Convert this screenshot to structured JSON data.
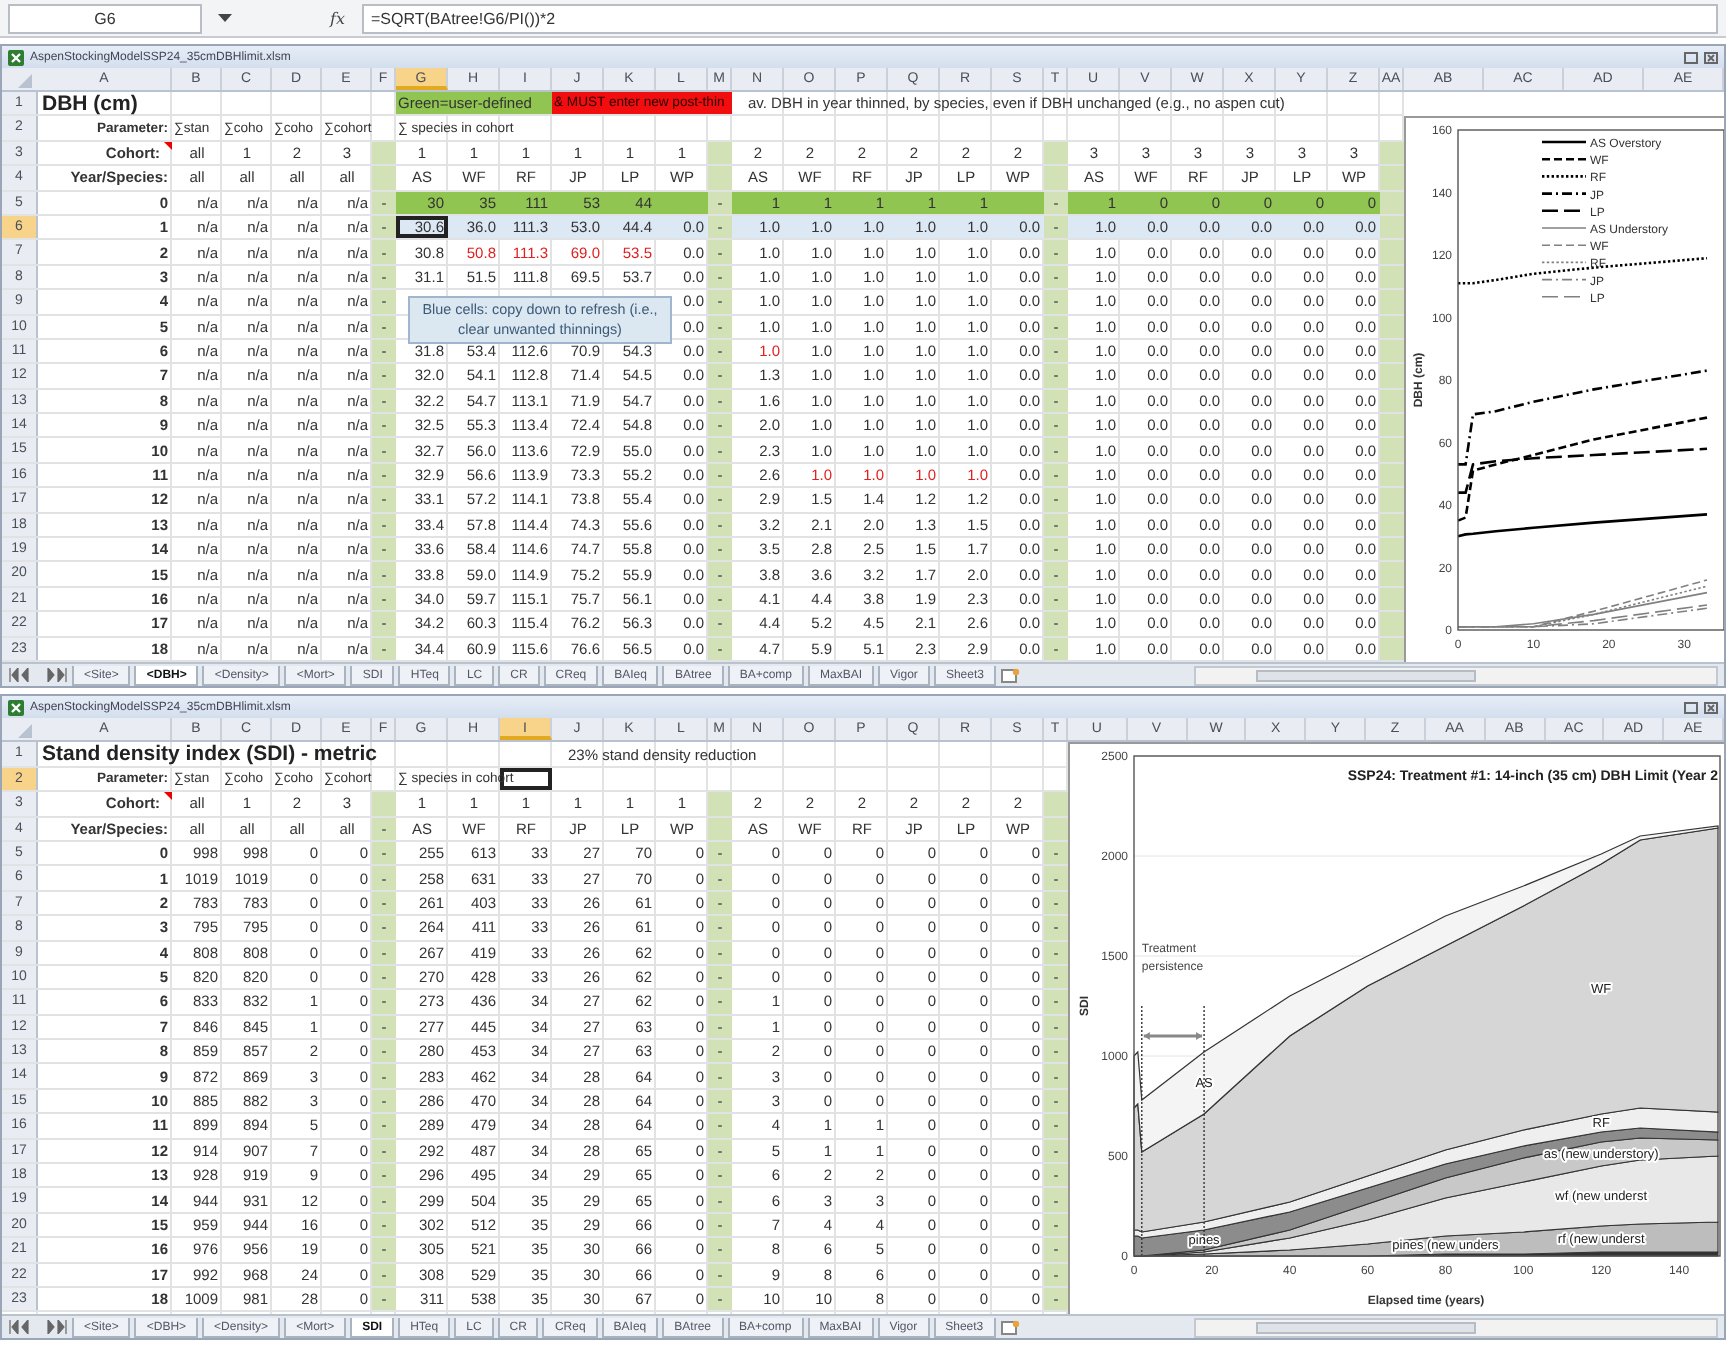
{
  "formula_bar": {
    "name_box": "G6",
    "fx": "fx",
    "formula": "=SQRT(BAtree!G6/PI())*2"
  },
  "windows": [
    {
      "title": "AspenStockingModelSSP24_35cmDBHlimit.xlsm",
      "columns": [
        {
          "label": "A",
          "selected": false
        },
        {
          "label": "B",
          "selected": false
        },
        {
          "label": "C",
          "selected": false
        },
        {
          "label": "D",
          "selected": false
        },
        {
          "label": "E",
          "selected": false
        },
        {
          "label": "F",
          "selected": false
        },
        {
          "label": "G",
          "selected": true
        },
        {
          "label": "H",
          "selected": false
        },
        {
          "label": "I",
          "selected": false
        },
        {
          "label": "J",
          "selected": false
        },
        {
          "label": "K",
          "selected": false
        },
        {
          "label": "L",
          "selected": false
        },
        {
          "label": "M",
          "selected": false
        },
        {
          "label": "N",
          "selected": false
        },
        {
          "label": "O",
          "selected": false
        },
        {
          "label": "P",
          "selected": false
        },
        {
          "label": "Q",
          "selected": false
        },
        {
          "label": "R",
          "selected": false
        },
        {
          "label": "S",
          "selected": false
        },
        {
          "label": "T",
          "selected": false
        },
        {
          "label": "U",
          "selected": false
        },
        {
          "label": "V",
          "selected": false
        },
        {
          "label": "W",
          "selected": false
        },
        {
          "label": "X",
          "selected": false
        },
        {
          "label": "Y",
          "selected": false
        },
        {
          "label": "Z",
          "selected": false
        },
        {
          "label": "AA",
          "selected": false
        },
        {
          "label": "AB",
          "selected": false
        },
        {
          "label": "AC",
          "selected": false
        },
        {
          "label": "AD",
          "selected": false
        },
        {
          "label": "AE",
          "selected": false
        }
      ],
      "rows": [
        {
          "num": "1",
          "selected": false,
          "cells": [
            {
              "text": "DBH (cm)",
              "kind": "title"
            },
            null,
            null,
            null,
            null,
            null,
            {
              "text": "Green=user-defined",
              "kind": "input"
            },
            {
              "kind": "input"
            },
            {
              "kind": "input"
            },
            {
              "text": "& MUST enter new post-thin",
              "kind": "alert"
            },
            {
              "kind": "alert"
            },
            {
              "kind": "alert"
            },
            {
              "kind": "alert"
            },
            {
              "text": "av. DBH in year thinned, by species, even if DBH unchanged (e.g., no aspen cut)",
              "kind": "note"
            }
          ]
        },
        {
          "num": "2",
          "selected": false,
          "cells": [
            "Parameter:",
            "∑stan",
            "∑coho",
            "∑coho",
            "∑cohort",
            null,
            "∑ species in cohort"
          ]
        },
        {
          "num": "3",
          "selected": false,
          "cells": [
            {
              "text": "Cohort:",
              "comment": true
            },
            "all",
            "1",
            "2",
            "3",
            null,
            "1",
            "1",
            "1",
            "1",
            "1",
            "1",
            null,
            "2",
            "2",
            "2",
            "2",
            "2",
            "2",
            null,
            "3",
            "3",
            "3",
            "3",
            "3",
            "3"
          ]
        },
        {
          "num": "4",
          "selected": false,
          "cells": [
            "Year/Species:",
            "all",
            "all",
            "all",
            "all",
            null,
            "AS",
            "WF",
            "RF",
            "JP",
            "LP",
            "WP",
            null,
            "AS",
            "WF",
            "RF",
            "JP",
            "LP",
            "WP",
            null,
            "AS",
            "WF",
            "RF",
            "JP",
            "LP",
            "WP"
          ]
        },
        {
          "num": "5",
          "selected": false,
          "kind": "input",
          "cells": [
            "0",
            "n/a",
            "n/a",
            "n/a",
            "n/a",
            "-",
            "30",
            "35",
            "111",
            "53",
            "44",
            null,
            "-",
            "1",
            "1",
            "1",
            "1",
            "1",
            null,
            "-",
            "1",
            "0",
            "0",
            "0",
            "0",
            "0"
          ]
        },
        {
          "num": "6",
          "selected": true,
          "kind": "refresh",
          "cells": [
            "1",
            "n/a",
            "n/a",
            "n/a",
            "n/a",
            "-",
            {
              "text": "30.6",
              "selected": true
            },
            "36.0",
            "111.3",
            "53.0",
            "44.4",
            "0.0",
            "-",
            "1.0",
            "1.0",
            "1.0",
            "1.0",
            "1.0",
            "0.0",
            "-",
            "1.0",
            "0.0",
            "0.0",
            "0.0",
            "0.0",
            "0.0"
          ]
        },
        {
          "num": "7",
          "selected": false,
          "cells": [
            "2",
            "n/a",
            "n/a",
            "n/a",
            "n/a",
            "-",
            "30.8",
            {
              "text": "50.8",
              "flagged": true
            },
            {
              "text": "111.3",
              "flagged": true
            },
            {
              "text": "69.0",
              "flagged": true
            },
            {
              "text": "53.5",
              "flagged": true
            },
            "0.0",
            "-",
            "1.0",
            "1.0",
            "1.0",
            "1.0",
            "1.0",
            "0.0",
            "-",
            "1.0",
            "0.0",
            "0.0",
            "0.0",
            "0.0",
            "0.0"
          ]
        },
        {
          "num": "8",
          "selected": false,
          "cells": [
            "3",
            "n/a",
            "n/a",
            "n/a",
            "n/a",
            "-",
            "31.1",
            "51.5",
            "111.8",
            "69.5",
            "53.7",
            "0.0",
            "-",
            "1.0",
            "1.0",
            "1.0",
            "1.0",
            "1.0",
            "0.0",
            "-",
            "1.0",
            "0.0",
            "0.0",
            "0.0",
            "0.0",
            "0.0"
          ]
        },
        {
          "num": "9",
          "selected": false,
          "cells": [
            "4",
            "n/a",
            "n/a",
            "n/a",
            "n/a",
            "-",
            null,
            null,
            null,
            null,
            null,
            "0.0",
            "-",
            "1.0",
            "1.0",
            "1.0",
            "1.0",
            "1.0",
            "0.0",
            "-",
            "1.0",
            "0.0",
            "0.0",
            "0.0",
            "0.0",
            "0.0"
          ]
        },
        {
          "num": "10",
          "selected": false,
          "cells": [
            "5",
            "n/a",
            "n/a",
            "n/a",
            "n/a",
            "-",
            null,
            null,
            null,
            null,
            null,
            "0.0",
            "-",
            "1.0",
            "1.0",
            "1.0",
            "1.0",
            "1.0",
            "0.0",
            "-",
            "1.0",
            "0.0",
            "0.0",
            "0.0",
            "0.0",
            "0.0"
          ]
        },
        {
          "num": "11",
          "selected": false,
          "cells": [
            "6",
            "n/a",
            "n/a",
            "n/a",
            "n/a",
            "-",
            "31.8",
            "53.4",
            "112.6",
            "70.9",
            "54.3",
            "0.0",
            "-",
            {
              "text": "1.0",
              "flagged": true
            },
            "1.0",
            "1.0",
            "1.0",
            "1.0",
            "0.0",
            "-",
            "1.0",
            "0.0",
            "0.0",
            "0.0",
            "0.0",
            "0.0"
          ]
        },
        {
          "num": "12",
          "selected": false,
          "cells": [
            "7",
            "n/a",
            "n/a",
            "n/a",
            "n/a",
            "-",
            "32.0",
            "54.1",
            "112.8",
            "71.4",
            "54.5",
            "0.0",
            "-",
            "1.3",
            "1.0",
            "1.0",
            "1.0",
            "1.0",
            "0.0",
            "-",
            "1.0",
            "0.0",
            "0.0",
            "0.0",
            "0.0",
            "0.0"
          ]
        },
        {
          "num": "13",
          "selected": false,
          "cells": [
            "8",
            "n/a",
            "n/a",
            "n/a",
            "n/a",
            "-",
            "32.2",
            "54.7",
            "113.1",
            "71.9",
            "54.7",
            "0.0",
            "-",
            "1.6",
            "1.0",
            "1.0",
            "1.0",
            "1.0",
            "0.0",
            "-",
            "1.0",
            "0.0",
            "0.0",
            "0.0",
            "0.0",
            "0.0"
          ]
        },
        {
          "num": "14",
          "selected": false,
          "cells": [
            "9",
            "n/a",
            "n/a",
            "n/a",
            "n/a",
            "-",
            "32.5",
            "55.3",
            "113.4",
            "72.4",
            "54.8",
            "0.0",
            "-",
            "2.0",
            "1.0",
            "1.0",
            "1.0",
            "1.0",
            "0.0",
            "-",
            "1.0",
            "0.0",
            "0.0",
            "0.0",
            "0.0",
            "0.0"
          ]
        },
        {
          "num": "15",
          "selected": false,
          "cells": [
            "10",
            "n/a",
            "n/a",
            "n/a",
            "n/a",
            "-",
            "32.7",
            "56.0",
            "113.6",
            "72.9",
            "55.0",
            "0.0",
            "-",
            "2.3",
            "1.0",
            "1.0",
            "1.0",
            "1.0",
            "0.0",
            "-",
            "1.0",
            "0.0",
            "0.0",
            "0.0",
            "0.0",
            "0.0"
          ]
        },
        {
          "num": "16",
          "selected": false,
          "cells": [
            "11",
            "n/a",
            "n/a",
            "n/a",
            "n/a",
            "-",
            "32.9",
            "56.6",
            "113.9",
            "73.3",
            "55.2",
            "0.0",
            "-",
            "2.6",
            {
              "text": "1.0",
              "flagged": true
            },
            {
              "text": "1.0",
              "flagged": true
            },
            {
              "text": "1.0",
              "flagged": true
            },
            {
              "text": "1.0",
              "flagged": true
            },
            "0.0",
            "-",
            "1.0",
            "0.0",
            "0.0",
            "0.0",
            "0.0",
            "0.0"
          ]
        },
        {
          "num": "17",
          "selected": false,
          "cells": [
            "12",
            "n/a",
            "n/a",
            "n/a",
            "n/a",
            "-",
            "33.1",
            "57.2",
            "114.1",
            "73.8",
            "55.4",
            "0.0",
            "-",
            "2.9",
            "1.5",
            "1.4",
            "1.2",
            "1.2",
            "0.0",
            "-",
            "1.0",
            "0.0",
            "0.0",
            "0.0",
            "0.0",
            "0.0"
          ]
        },
        {
          "num": "18",
          "selected": false,
          "cells": [
            "13",
            "n/a",
            "n/a",
            "n/a",
            "n/a",
            "-",
            "33.4",
            "57.8",
            "114.4",
            "74.3",
            "55.6",
            "0.0",
            "-",
            "3.2",
            "2.1",
            "2.0",
            "1.3",
            "1.5",
            "0.0",
            "-",
            "1.0",
            "0.0",
            "0.0",
            "0.0",
            "0.0",
            "0.0"
          ]
        },
        {
          "num": "19",
          "selected": false,
          "cells": [
            "14",
            "n/a",
            "n/a",
            "n/a",
            "n/a",
            "-",
            "33.6",
            "58.4",
            "114.6",
            "74.7",
            "55.8",
            "0.0",
            "-",
            "3.5",
            "2.8",
            "2.5",
            "1.5",
            "1.7",
            "0.0",
            "-",
            "1.0",
            "0.0",
            "0.0",
            "0.0",
            "0.0",
            "0.0"
          ]
        },
        {
          "num": "20",
          "selected": false,
          "cells": [
            "15",
            "n/a",
            "n/a",
            "n/a",
            "n/a",
            "-",
            "33.8",
            "59.0",
            "114.9",
            "75.2",
            "55.9",
            "0.0",
            "-",
            "3.8",
            "3.6",
            "3.2",
            "1.7",
            "2.0",
            "0.0",
            "-",
            "1.0",
            "0.0",
            "0.0",
            "0.0",
            "0.0",
            "0.0"
          ]
        },
        {
          "num": "21",
          "selected": false,
          "cells": [
            "16",
            "n/a",
            "n/a",
            "n/a",
            "n/a",
            "-",
            "34.0",
            "59.7",
            "115.1",
            "75.7",
            "56.1",
            "0.0",
            "-",
            "4.1",
            "4.4",
            "3.8",
            "1.9",
            "2.3",
            "0.0",
            "-",
            "1.0",
            "0.0",
            "0.0",
            "0.0",
            "0.0",
            "0.0"
          ]
        },
        {
          "num": "22",
          "selected": false,
          "cells": [
            "17",
            "n/a",
            "n/a",
            "n/a",
            "n/a",
            "-",
            "34.2",
            "60.3",
            "115.4",
            "76.2",
            "56.3",
            "0.0",
            "-",
            "4.4",
            "5.2",
            "4.5",
            "2.1",
            "2.6",
            "0.0",
            "-",
            "1.0",
            "0.0",
            "0.0",
            "0.0",
            "0.0",
            "0.0"
          ]
        },
        {
          "num": "23",
          "selected": false,
          "cells": [
            "18",
            "n/a",
            "n/a",
            "n/a",
            "n/a",
            "-",
            "34.4",
            "60.9",
            "115.6",
            "76.6",
            "56.5",
            "0.0",
            "-",
            "4.7",
            "5.9",
            "5.1",
            "2.3",
            "2.9",
            "0.0",
            "-",
            "1.0",
            "0.0",
            "0.0",
            "0.0",
            "0.0",
            "0.0"
          ]
        }
      ],
      "comment": "Blue cells: copy down to refresh (i.e., clear unwanted thinnings)",
      "chart_data": {
        "type": "line",
        "ylabel": "DBH (cm)",
        "x": [
          0,
          1,
          2,
          5,
          10,
          18,
          33
        ],
        "xlim": [
          0,
          35
        ],
        "ylim": [
          0,
          160
        ],
        "xticks": [
          0,
          10,
          20,
          30
        ],
        "yticks": [
          0,
          20,
          40,
          60,
          80,
          100,
          120,
          140,
          160
        ],
        "legend": "top",
        "series": [
          {
            "name": "AS Overstory",
            "color": "#000000",
            "line_style": "solid",
            "values": [
              30,
              30.6,
              30.8,
              31.6,
              32.7,
              34.4,
              37
            ]
          },
          {
            "name": "WF",
            "color": "#000000",
            "line_style": "dashed",
            "values": [
              35,
              36,
              51,
              53,
              56,
              61,
              68
            ]
          },
          {
            "name": "RF",
            "color": "#000000",
            "line_style": "dotted",
            "values": [
              111,
              111,
              111,
              112,
              114,
              116,
              119
            ]
          },
          {
            "name": "JP",
            "color": "#000000",
            "line_style": "dashdot",
            "values": [
              53,
              53,
              69,
              70,
              73,
              77,
              83
            ]
          },
          {
            "name": "LP",
            "color": "#000000",
            "line_style": "longdash",
            "values": [
              44,
              44,
              53,
              54,
              55,
              56,
              58
            ]
          },
          {
            "name": "AS Understory",
            "color": "#808080",
            "line_style": "solid",
            "values": [
              1,
              1,
              1,
              1,
              2,
              5,
              12
            ]
          },
          {
            "name": "WF",
            "color": "#808080",
            "line_style": "dashed",
            "values": [
              1,
              1,
              1,
              1,
              1,
              6,
              16
            ]
          },
          {
            "name": "RF",
            "color": "#808080",
            "line_style": "dotted",
            "values": [
              1,
              1,
              1,
              1,
              1,
              5,
              14
            ]
          },
          {
            "name": "JP",
            "color": "#808080",
            "line_style": "dashdot",
            "values": [
              1,
              1,
              1,
              1,
              1,
              2,
              7
            ]
          },
          {
            "name": "LP",
            "color": "#808080",
            "line_style": "longdash",
            "values": [
              1,
              1,
              1,
              1,
              1,
              3,
              8
            ]
          }
        ]
      },
      "sheet_tabs": [
        {
          "label": "<Site>",
          "selected": false
        },
        {
          "label": "<DBH>",
          "selected": true
        },
        {
          "label": "<Density>",
          "selected": false
        },
        {
          "label": "<Mort>",
          "selected": false
        },
        {
          "label": "SDI",
          "selected": false
        },
        {
          "label": "HTeq",
          "selected": false
        },
        {
          "label": "LC",
          "selected": false
        },
        {
          "label": "CR",
          "selected": false
        },
        {
          "label": "CReq",
          "selected": false
        },
        {
          "label": "BAIeq",
          "selected": false
        },
        {
          "label": "BAtree",
          "selected": false
        },
        {
          "label": "BA+comp",
          "selected": false
        },
        {
          "label": "MaxBAI",
          "selected": false
        },
        {
          "label": "Vigor",
          "selected": false
        },
        {
          "label": "Sheet3",
          "selected": false
        }
      ]
    },
    {
      "title": "AspenStockingModelSSP24_35cmDBHlimit.xlsm",
      "columns": [
        {
          "label": "A",
          "selected": false
        },
        {
          "label": "B",
          "selected": false
        },
        {
          "label": "C",
          "selected": false
        },
        {
          "label": "D",
          "selected": false
        },
        {
          "label": "E",
          "selected": false
        },
        {
          "label": "F",
          "selected": false
        },
        {
          "label": "G",
          "selected": false
        },
        {
          "label": "H",
          "selected": false
        },
        {
          "label": "I",
          "selected": true
        },
        {
          "label": "J",
          "selected": false
        },
        {
          "label": "K",
          "selected": false
        },
        {
          "label": "L",
          "selected": false
        },
        {
          "label": "M",
          "selected": false
        },
        {
          "label": "N",
          "selected": false
        },
        {
          "label": "O",
          "selected": false
        },
        {
          "label": "P",
          "selected": false
        },
        {
          "label": "Q",
          "selected": false
        },
        {
          "label": "R",
          "selected": false
        },
        {
          "label": "S",
          "selected": false
        },
        {
          "label": "T",
          "selected": false
        },
        {
          "label": "U",
          "selected": false
        },
        {
          "label": "V",
          "selected": false
        },
        {
          "label": "W",
          "selected": false
        },
        {
          "label": "X",
          "selected": false
        },
        {
          "label": "Y",
          "selected": false
        },
        {
          "label": "Z",
          "selected": false
        },
        {
          "label": "AA",
          "selected": false
        },
        {
          "label": "AB",
          "selected": false
        },
        {
          "label": "AC",
          "selected": false
        },
        {
          "label": "AD",
          "selected": false
        },
        {
          "label": "AE",
          "selected": false
        }
      ],
      "rows": [
        {
          "num": "1",
          "selected": false,
          "cells": [
            {
              "text": "Stand density index (SDI) - metric",
              "kind": "title"
            },
            null,
            null,
            null,
            null,
            null,
            null,
            null,
            null,
            {
              "text": "23% stand density reduction",
              "kind": "note"
            }
          ]
        },
        {
          "num": "2",
          "selected": true,
          "cells": [
            "Parameter:",
            "∑stan",
            "∑coho",
            "∑coho",
            "∑cohort",
            null,
            "∑ species in cohort",
            null,
            {
              "selected": true
            }
          ]
        },
        {
          "num": "3",
          "selected": false,
          "cells": [
            {
              "text": "Cohort:",
              "comment": true
            },
            "all",
            "1",
            "2",
            "3",
            null,
            "1",
            "1",
            "1",
            "1",
            "1",
            "1",
            null,
            "2",
            "2",
            "2",
            "2",
            "2",
            "2"
          ]
        },
        {
          "num": "4",
          "selected": false,
          "cells": [
            "Year/Species:",
            "all",
            "all",
            "all",
            "all",
            "-",
            "AS",
            "WF",
            "RF",
            "JP",
            "LP",
            "WP",
            null,
            "AS",
            "WF",
            "RF",
            "JP",
            "LP",
            "WP"
          ]
        },
        {
          "num": "5",
          "selected": false,
          "cells": [
            "0",
            "998",
            "998",
            "0",
            "0",
            "-",
            "255",
            "613",
            "33",
            "27",
            "70",
            "0",
            "-",
            "0",
            "0",
            "0",
            "0",
            "0",
            "0",
            "-"
          ]
        },
        {
          "num": "6",
          "selected": false,
          "cells": [
            "1",
            "1019",
            "1019",
            "0",
            "0",
            "-",
            "258",
            "631",
            "33",
            "27",
            "70",
            "0",
            "-",
            "0",
            "0",
            "0",
            "0",
            "0",
            "0",
            "-"
          ]
        },
        {
          "num": "7",
          "selected": false,
          "cells": [
            "2",
            "783",
            "783",
            "0",
            "0",
            "-",
            "261",
            "403",
            "33",
            "26",
            "61",
            "0",
            "-",
            "0",
            "0",
            "0",
            "0",
            "0",
            "0",
            "-"
          ]
        },
        {
          "num": "8",
          "selected": false,
          "cells": [
            "3",
            "795",
            "795",
            "0",
            "0",
            "-",
            "264",
            "411",
            "33",
            "26",
            "61",
            "0",
            "-",
            "0",
            "0",
            "0",
            "0",
            "0",
            "0",
            "-"
          ]
        },
        {
          "num": "9",
          "selected": false,
          "cells": [
            "4",
            "808",
            "808",
            "0",
            "0",
            "-",
            "267",
            "419",
            "33",
            "26",
            "62",
            "0",
            "-",
            "0",
            "0",
            "0",
            "0",
            "0",
            "0",
            "-"
          ]
        },
        {
          "num": "10",
          "selected": false,
          "cells": [
            "5",
            "820",
            "820",
            "0",
            "0",
            "-",
            "270",
            "428",
            "33",
            "26",
            "62",
            "0",
            "-",
            "0",
            "0",
            "0",
            "0",
            "0",
            "0",
            "-"
          ]
        },
        {
          "num": "11",
          "selected": false,
          "cells": [
            "6",
            "833",
            "832",
            "1",
            "0",
            "-",
            "273",
            "436",
            "34",
            "27",
            "62",
            "0",
            "-",
            "1",
            "0",
            "0",
            "0",
            "0",
            "0",
            "-"
          ]
        },
        {
          "num": "12",
          "selected": false,
          "cells": [
            "7",
            "846",
            "845",
            "1",
            "0",
            "-",
            "277",
            "445",
            "34",
            "27",
            "63",
            "0",
            "-",
            "1",
            "0",
            "0",
            "0",
            "0",
            "0",
            "-"
          ]
        },
        {
          "num": "13",
          "selected": false,
          "cells": [
            "8",
            "859",
            "857",
            "2",
            "0",
            "-",
            "280",
            "453",
            "34",
            "27",
            "63",
            "0",
            "-",
            "2",
            "0",
            "0",
            "0",
            "0",
            "0",
            "-"
          ]
        },
        {
          "num": "14",
          "selected": false,
          "cells": [
            "9",
            "872",
            "869",
            "3",
            "0",
            "-",
            "283",
            "462",
            "34",
            "28",
            "64",
            "0",
            "-",
            "3",
            "0",
            "0",
            "0",
            "0",
            "0",
            "-"
          ]
        },
        {
          "num": "15",
          "selected": false,
          "cells": [
            "10",
            "885",
            "882",
            "3",
            "0",
            "-",
            "286",
            "470",
            "34",
            "28",
            "64",
            "0",
            "-",
            "3",
            "0",
            "0",
            "0",
            "0",
            "0",
            "-"
          ]
        },
        {
          "num": "16",
          "selected": false,
          "cells": [
            "11",
            "899",
            "894",
            "5",
            "0",
            "-",
            "289",
            "479",
            "34",
            "28",
            "64",
            "0",
            "-",
            "4",
            "1",
            "1",
            "0",
            "0",
            "0",
            "-"
          ]
        },
        {
          "num": "17",
          "selected": false,
          "cells": [
            "12",
            "914",
            "907",
            "7",
            "0",
            "-",
            "292",
            "487",
            "34",
            "28",
            "65",
            "0",
            "-",
            "5",
            "1",
            "1",
            "0",
            "0",
            "0",
            "-"
          ]
        },
        {
          "num": "18",
          "selected": false,
          "cells": [
            "13",
            "928",
            "919",
            "9",
            "0",
            "-",
            "296",
            "495",
            "34",
            "29",
            "65",
            "0",
            "-",
            "6",
            "2",
            "2",
            "0",
            "0",
            "0",
            "-"
          ]
        },
        {
          "num": "19",
          "selected": false,
          "cells": [
            "14",
            "944",
            "931",
            "12",
            "0",
            "-",
            "299",
            "504",
            "35",
            "29",
            "65",
            "0",
            "-",
            "6",
            "3",
            "3",
            "0",
            "0",
            "0",
            "-"
          ]
        },
        {
          "num": "20",
          "selected": false,
          "cells": [
            "15",
            "959",
            "944",
            "16",
            "0",
            "-",
            "302",
            "512",
            "35",
            "29",
            "66",
            "0",
            "-",
            "7",
            "4",
            "4",
            "0",
            "0",
            "0",
            "-"
          ]
        },
        {
          "num": "21",
          "selected": false,
          "cells": [
            "16",
            "976",
            "956",
            "19",
            "0",
            "-",
            "305",
            "521",
            "35",
            "30",
            "66",
            "0",
            "-",
            "8",
            "6",
            "5",
            "0",
            "0",
            "0",
            "-"
          ]
        },
        {
          "num": "22",
          "selected": false,
          "cells": [
            "17",
            "992",
            "968",
            "24",
            "0",
            "-",
            "308",
            "529",
            "35",
            "30",
            "66",
            "0",
            "-",
            "9",
            "8",
            "6",
            "0",
            "0",
            "0",
            "-"
          ]
        },
        {
          "num": "23",
          "selected": false,
          "cells": [
            "18",
            "1009",
            "981",
            "28",
            "0",
            "-",
            "311",
            "538",
            "35",
            "30",
            "67",
            "0",
            "-",
            "10",
            "10",
            "8",
            "0",
            "0",
            "0",
            "-"
          ]
        }
      ],
      "chart_data": {
        "type": "area",
        "stacked": true,
        "grid": true,
        "title": "SSP24: Treatment #1: 14-inch (35 cm) DBH Limit (Year 2",
        "xlabel": "Elapsed time (years)",
        "ylabel": "SDI",
        "x": [
          0,
          1,
          2,
          18,
          40,
          60,
          80,
          100,
          120,
          130,
          150
        ],
        "xlim": [
          0,
          150
        ],
        "ylim": [
          0,
          2500
        ],
        "xticks": [
          0,
          20,
          40,
          60,
          80,
          100,
          120,
          140
        ],
        "yticks": [
          0,
          500,
          1000,
          1500,
          2000,
          2500
        ],
        "series": [
          {
            "name": "pines (new unders",
            "color": "#333333",
            "values": [
              0,
              0,
              0,
              0,
              0,
              0,
              10,
              10,
              20,
              20,
              20
            ]
          },
          {
            "name": "rf (new underst",
            "color": "#bdbdbd",
            "values": [
              0,
              0,
              0,
              10,
              30,
              60,
              90,
              110,
              130,
              140,
              150
            ]
          },
          {
            "name": "wf (new underst",
            "color": "#e8e8e8",
            "values": [
              0,
              0,
              0,
              10,
              60,
              120,
              190,
              250,
              300,
              320,
              330
            ]
          },
          {
            "name": "as (new understory)",
            "color": "#c8c8c8",
            "values": [
              0,
              0,
              0,
              10,
              40,
              80,
              100,
              120,
              120,
              110,
              80
            ]
          },
          {
            "name": "pines",
            "color": "#8c8c8c",
            "values": [
              100,
              100,
              90,
              100,
              90,
              80,
              70,
              60,
              50,
              50,
              40
            ]
          },
          {
            "name": "RF",
            "color": "#efefef",
            "values": [
              30,
              30,
              30,
              40,
              50,
              60,
              70,
              80,
              90,
              100,
              100
            ]
          },
          {
            "name": "WF",
            "color": "#d6d6d6",
            "values": [
              610,
              630,
              400,
              540,
              830,
              950,
              1020,
              1120,
              1250,
              1340,
              1420
            ]
          },
          {
            "name": "AS",
            "color": "#f4f4f4",
            "values": [
              260,
              260,
              260,
              310,
              200,
              150,
              150,
              100,
              50,
              20,
              10
            ]
          }
        ],
        "annotations": [
          "Treatment persistence"
        ]
      },
      "sheet_tabs": [
        {
          "label": "<Site>",
          "selected": false
        },
        {
          "label": "<DBH>",
          "selected": false
        },
        {
          "label": "<Density>",
          "selected": false
        },
        {
          "label": "<Mort>",
          "selected": false
        },
        {
          "label": "SDI",
          "selected": true
        },
        {
          "label": "HTeq",
          "selected": false
        },
        {
          "label": "LC",
          "selected": false
        },
        {
          "label": "CR",
          "selected": false
        },
        {
          "label": "CReq",
          "selected": false
        },
        {
          "label": "BAIeq",
          "selected": false
        },
        {
          "label": "BAtree",
          "selected": false
        },
        {
          "label": "BA+comp",
          "selected": false
        },
        {
          "label": "MaxBAI",
          "selected": false
        },
        {
          "label": "Vigor",
          "selected": false
        },
        {
          "label": "Sheet3",
          "selected": false
        }
      ]
    }
  ]
}
